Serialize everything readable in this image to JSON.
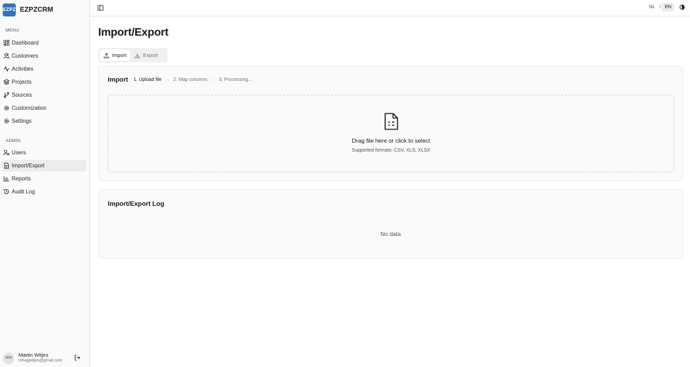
{
  "brand": {
    "logo_text": "EZPZ",
    "name": "EZPZCRM",
    "logo_color": "#2f74c0"
  },
  "sidebar": {
    "menu_label": "MENU",
    "menu_items": [
      {
        "label": "Dashboard",
        "icon": "dashboard-icon"
      },
      {
        "label": "Customers",
        "icon": "users-icon"
      },
      {
        "label": "Activities",
        "icon": "activity-icon"
      },
      {
        "label": "Projects",
        "icon": "layers-icon"
      },
      {
        "label": "Sources",
        "icon": "git-branch-icon"
      },
      {
        "label": "Customization",
        "icon": "gear-icon"
      },
      {
        "label": "Settings",
        "icon": "settings-icon"
      }
    ],
    "admin_label": "ADMIN",
    "admin_items": [
      {
        "label": "Users",
        "icon": "user-cog-icon"
      },
      {
        "label": "Import/Export",
        "icon": "file-icon",
        "active": true
      },
      {
        "label": "Reports",
        "icon": "bar-chart-icon"
      },
      {
        "label": "Audit Log",
        "icon": "history-icon"
      }
    ]
  },
  "user": {
    "initials": "MW",
    "name": "Martin Witjes",
    "email": "mhagwitjes@gmail.com"
  },
  "topbar": {
    "lang_nl": "NL",
    "lang_sep": "/",
    "lang_en": "EN",
    "active_lang": "EN"
  },
  "page": {
    "title": "Import/Export"
  },
  "tabs": {
    "import": "Import",
    "export": "Export",
    "active": "Import"
  },
  "import_card": {
    "title": "Import",
    "steps": [
      "1. Upload file",
      "2. Map columns",
      "3. Processing..."
    ],
    "arrow": "→",
    "drop_title": "Drag file here or click to select",
    "drop_sub": "Supported formats: CSV, XLS, XLSX"
  },
  "log_card": {
    "title": "Import/Export Log",
    "empty_text": "No data"
  }
}
